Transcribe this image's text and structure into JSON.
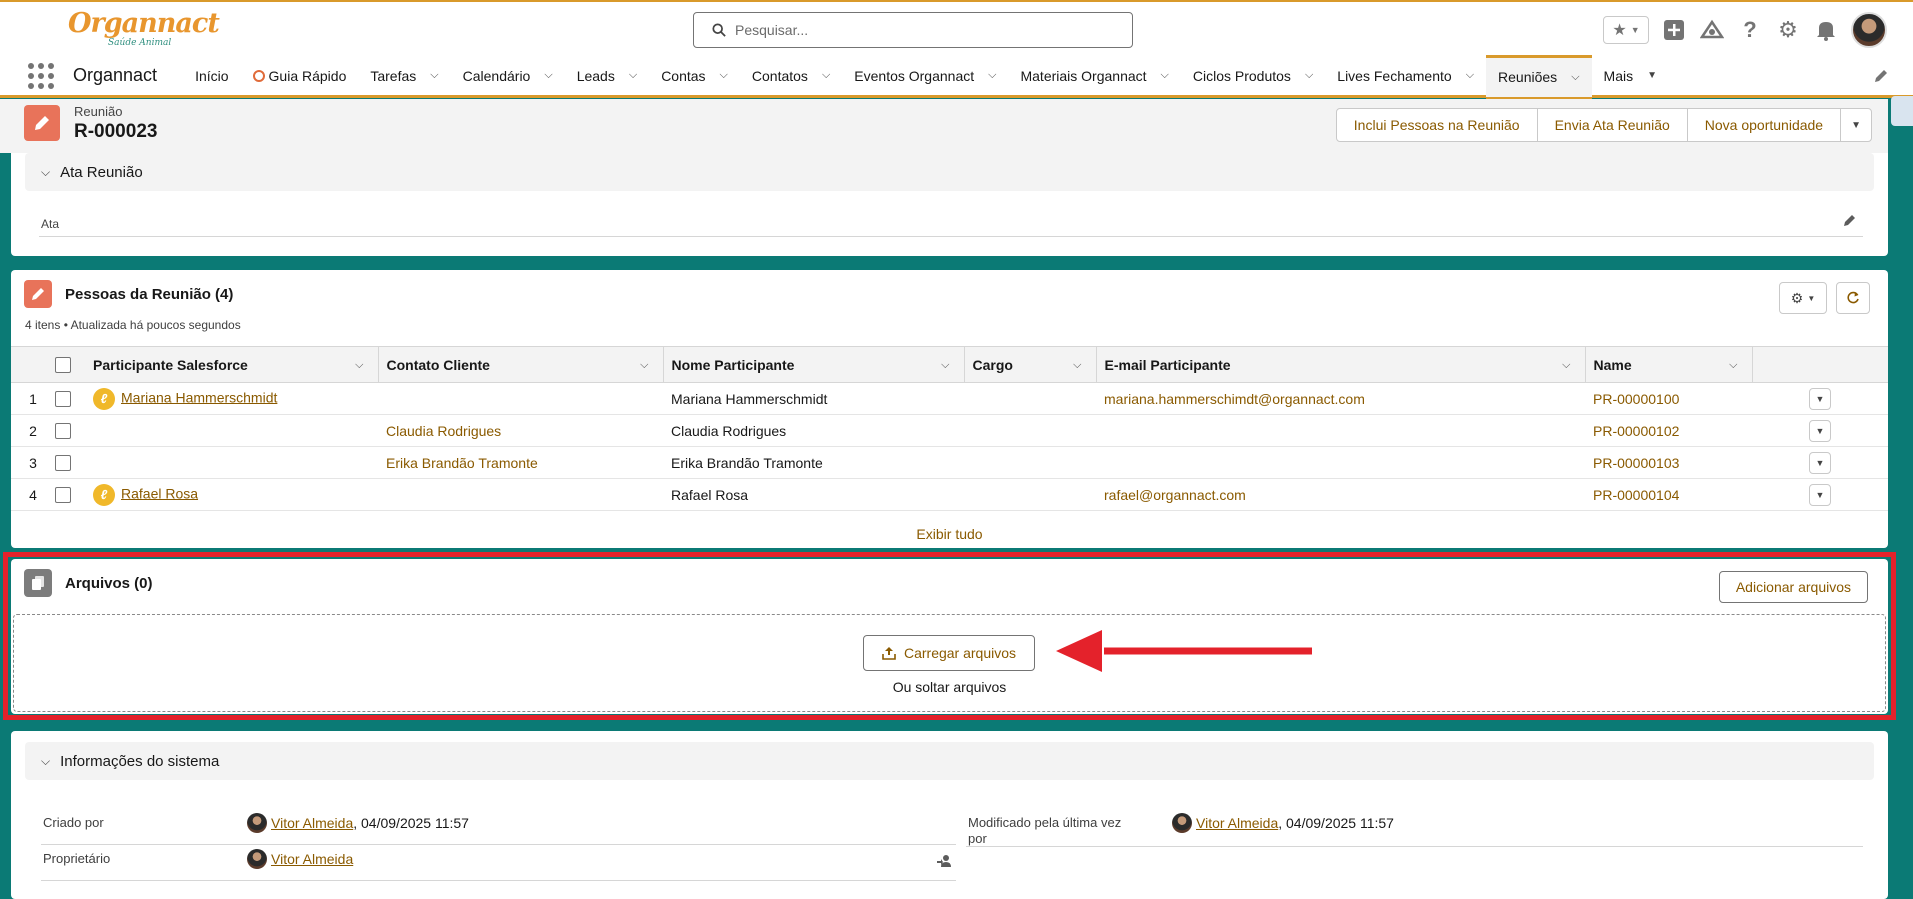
{
  "header": {
    "logo_text": "Organnact",
    "logo_tagline": "Saúde Animal",
    "search_placeholder": "Pesquisar..."
  },
  "nav": {
    "app_name": "Organnact",
    "items": [
      {
        "label": "Início",
        "has_menu": false
      },
      {
        "label": "Guia Rápido",
        "has_menu": false
      },
      {
        "label": "Tarefas",
        "has_menu": true
      },
      {
        "label": "Calendário",
        "has_menu": true
      },
      {
        "label": "Leads",
        "has_menu": true
      },
      {
        "label": "Contas",
        "has_menu": true
      },
      {
        "label": "Contatos",
        "has_menu": true
      },
      {
        "label": "Eventos Organnact",
        "has_menu": true
      },
      {
        "label": "Materiais Organnact",
        "has_menu": true
      },
      {
        "label": "Ciclos Produtos",
        "has_menu": true
      },
      {
        "label": "Lives Fechamento",
        "has_menu": true
      },
      {
        "label": "Reuniões",
        "has_menu": true,
        "active": true
      },
      {
        "label": "Mais",
        "has_menu": true
      }
    ]
  },
  "record": {
    "type": "Reunião",
    "name": "R-000023",
    "actions": [
      "Inclui Pessoas na Reunião",
      "Envia Ata Reunião",
      "Nova oportunidade"
    ]
  },
  "ata_section": {
    "title": "Ata Reunião",
    "field_label": "Ata"
  },
  "people": {
    "title": "Pessoas da Reunião (4)",
    "subtitle": "4 itens • Atualizada há poucos segundos",
    "columns": [
      "Participante Salesforce",
      "Contato Cliente",
      "Nome Participante",
      "Cargo",
      "E-mail Participante",
      "Name"
    ],
    "rows": [
      {
        "num": "1",
        "participante": "Mariana Hammerschmidt",
        "contato": "",
        "nome": "Mariana Hammerschmidt",
        "cargo": "",
        "email": "mariana.hammerschimdt@organnact.com",
        "name": "PR-00000100"
      },
      {
        "num": "2",
        "participante": "",
        "contato": "Claudia Rodrigues",
        "nome": "Claudia Rodrigues",
        "cargo": "",
        "email": "",
        "name": "PR-00000102"
      },
      {
        "num": "3",
        "participante": "",
        "contato": "Erika Brandão Tramonte",
        "nome": "Erika Brandão Tramonte",
        "cargo": "",
        "email": "",
        "name": "PR-00000103"
      },
      {
        "num": "4",
        "participante": "Rafael Rosa",
        "contato": "",
        "nome": "Rafael Rosa",
        "cargo": "",
        "email": "rafael@organnact.com",
        "name": "PR-00000104"
      }
    ],
    "view_all": "Exibir tudo"
  },
  "files": {
    "title": "Arquivos (0)",
    "add_button": "Adicionar arquivos",
    "upload_button": "Carregar arquivos",
    "drop_text": "Ou soltar arquivos"
  },
  "system": {
    "title": "Informações do sistema",
    "created_by_label": "Criado por",
    "created_by_user": "Vitor Almeida",
    "created_by_date": ", 04/09/2025 11:57",
    "modified_by_label_1": "Modificado pela última vez",
    "modified_by_label_2": "por",
    "modified_by_user": "Vitor Almeida",
    "modified_by_date": ", 04/09/2025 11:57",
    "owner_label": "Proprietário",
    "owner_user": "Vitor Almeida"
  },
  "colors": {
    "accent": "#d99a2b",
    "link": "#8a5a00",
    "background": "#0b7a75",
    "record_icon": "#e8735a",
    "highlight": "#e4222b"
  }
}
